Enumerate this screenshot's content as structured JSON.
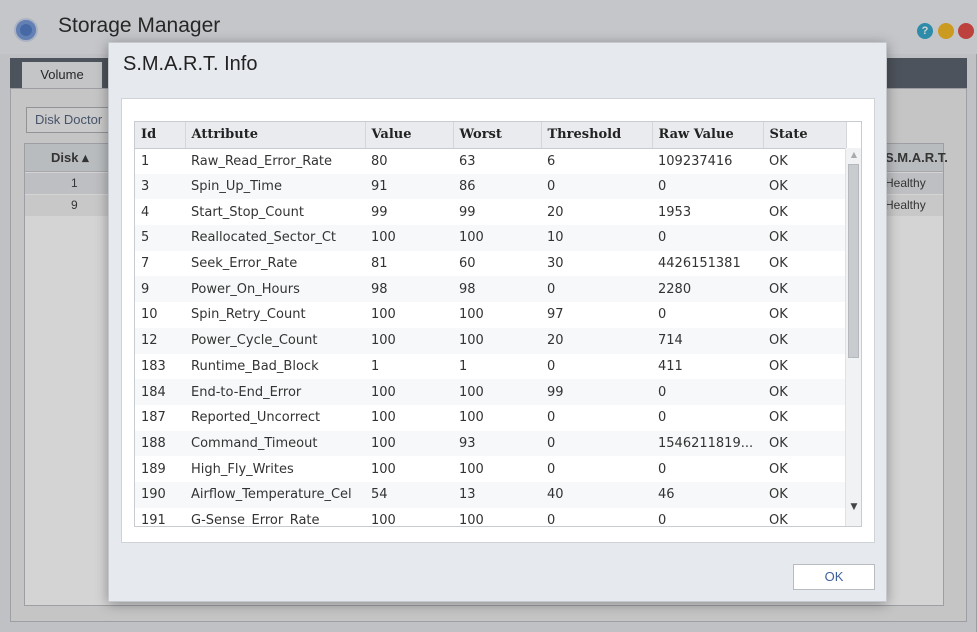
{
  "app": {
    "title": "Storage Manager",
    "window_buttons": {
      "help_glyph": "?",
      "minimize_glyph": "–",
      "close_glyph": "×"
    }
  },
  "tabs": {
    "volume": "Volume"
  },
  "toolbar": {
    "disk_doctor": "Disk Doctor"
  },
  "disk_table": {
    "columns": {
      "disk": "Disk ▴",
      "smart": "S.M.A.R.T."
    },
    "rows": [
      {
        "disk": "1",
        "smart": "Healthy"
      },
      {
        "disk": "9",
        "smart": "Healthy"
      }
    ]
  },
  "dialog": {
    "title": "S.M.A.R.T. Info",
    "ok_label": "OK",
    "columns": [
      "Id",
      "Attribute",
      "Value",
      "Worst",
      "Threshold",
      "Raw Value",
      "State"
    ],
    "rows": [
      [
        "1",
        "Raw_Read_Error_Rate",
        "80",
        "63",
        "6",
        "109237416",
        "OK"
      ],
      [
        "3",
        "Spin_Up_Time",
        "91",
        "86",
        "0",
        "0",
        "OK"
      ],
      [
        "4",
        "Start_Stop_Count",
        "99",
        "99",
        "20",
        "1953",
        "OK"
      ],
      [
        "5",
        "Reallocated_Sector_Ct",
        "100",
        "100",
        "10",
        "0",
        "OK"
      ],
      [
        "7",
        "Seek_Error_Rate",
        "81",
        "60",
        "30",
        "4426151381",
        "OK"
      ],
      [
        "9",
        "Power_On_Hours",
        "98",
        "98",
        "0",
        "2280",
        "OK"
      ],
      [
        "10",
        "Spin_Retry_Count",
        "100",
        "100",
        "97",
        "0",
        "OK"
      ],
      [
        "12",
        "Power_Cycle_Count",
        "100",
        "100",
        "20",
        "714",
        "OK"
      ],
      [
        "183",
        "Runtime_Bad_Block",
        "1",
        "1",
        "0",
        "411",
        "OK"
      ],
      [
        "184",
        "End-to-End_Error",
        "100",
        "100",
        "99",
        "0",
        "OK"
      ],
      [
        "187",
        "Reported_Uncorrect",
        "100",
        "100",
        "0",
        "0",
        "OK"
      ],
      [
        "188",
        "Command_Timeout",
        "100",
        "93",
        "0",
        "1546211819...",
        "OK"
      ],
      [
        "189",
        "High_Fly_Writes",
        "100",
        "100",
        "0",
        "0",
        "OK"
      ],
      [
        "190",
        "Airflow_Temperature_Cel",
        "54",
        "13",
        "40",
        "46",
        "OK"
      ],
      [
        "191",
        "G-Sense_Error_Rate",
        "100",
        "100",
        "0",
        "0",
        "OK"
      ]
    ]
  },
  "icons": {
    "app_logo": "storage-manager-logo-icon",
    "scroll_up": "scroll-up-arrow-icon",
    "scroll_down": "scroll-down-arrow-icon"
  },
  "colors": {
    "tabbar": "#525a66",
    "help": "#2aa3c9",
    "minimize": "#f2b51a",
    "close": "#e2453f",
    "ok_text": "#3f5f9c"
  }
}
